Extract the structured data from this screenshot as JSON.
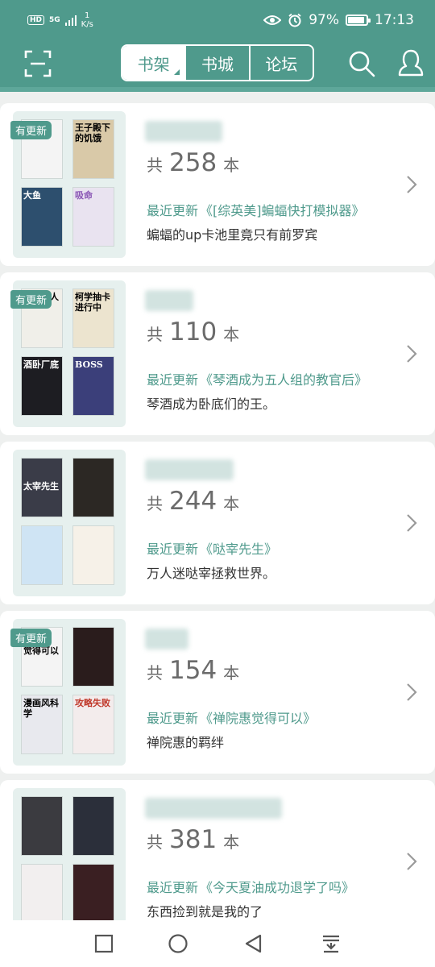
{
  "status_bar": {
    "hd": "HD",
    "net": "5G",
    "speed_value": "1",
    "speed_unit": "K/s",
    "battery": "97%",
    "time": "17:13",
    "icons": [
      "eye-icon",
      "alarm-icon",
      "battery-icon"
    ]
  },
  "header": {
    "tabs": [
      {
        "label": "书架",
        "active": true
      },
      {
        "label": "书城",
        "active": false
      },
      {
        "label": "论坛",
        "active": false
      }
    ],
    "icons": [
      "scan-icon",
      "search-icon",
      "user-icon"
    ]
  },
  "colors": {
    "accent": "#4f9a8c",
    "background": "#eef0ef"
  },
  "count_prefix": "共",
  "count_unit": "本",
  "latest_label": "最近更新",
  "badge_label": "有更新",
  "shelves": [
    {
      "has_update": true,
      "count": "258",
      "latest": "《[综英美]蝙蝠快打模拟器》",
      "desc": "蝙蝠的up卡池里竟只有前罗宾",
      "covers": [
        {
          "title": "",
          "color": "#f4f4f4"
        },
        {
          "title": "王子殿下的饥饿",
          "color": "#d9c9a8"
        },
        {
          "title": "大鱼",
          "color": "#2d4f6e"
        },
        {
          "title": "吸命",
          "color": "#e9e3f0"
        }
      ]
    },
    {
      "has_update": true,
      "count": "110",
      "latest": "《琴酒成为五人组的教官后》",
      "desc": "琴酒成为卧底们的王。",
      "covers": [
        {
          "title": "我与老人",
          "color": "#f0efe9"
        },
        {
          "title": "柯学抽卡进行中",
          "color": "#ece4cf"
        },
        {
          "title": "酒卧厂底",
          "color": "#1d1d22"
        },
        {
          "title": "BOSS",
          "color": "#3b3f7a"
        }
      ]
    },
    {
      "has_update": false,
      "count": "244",
      "latest": "《哒宰先生》",
      "desc": "万人迷哒宰拯救世界。",
      "covers": [
        {
          "title": "太宰先生",
          "color": "#3a3c48"
        },
        {
          "title": "",
          "color": "#2c2824"
        },
        {
          "title": "",
          "color": "#cfe4f4"
        },
        {
          "title": "",
          "color": "#f6f1e8"
        }
      ]
    },
    {
      "has_update": true,
      "count": "154",
      "latest": "《禅院惠觉得可以》",
      "desc": "禅院惠的羁绊",
      "covers": [
        {
          "title": "觉得可以",
          "color": "#f4f4f4"
        },
        {
          "title": "",
          "color": "#2a1c1c"
        },
        {
          "title": "漫画风科学",
          "color": "#e8e9ee"
        },
        {
          "title": "攻略失败",
          "color": "#f3ecec"
        }
      ]
    },
    {
      "has_update": false,
      "count": "381",
      "latest": "《今天夏油成功退学了吗》",
      "desc": "东西捡到就是我的了",
      "covers": [
        {
          "title": "",
          "color": "#3b3b40"
        },
        {
          "title": "",
          "color": "#2b2f3a"
        },
        {
          "title": "",
          "color": "#f2efef"
        },
        {
          "title": "",
          "color": "#3a1f22"
        }
      ]
    }
  ],
  "nav": {
    "icons": [
      "recent-apps-icon",
      "home-icon",
      "back-icon",
      "notification-pull-icon"
    ]
  }
}
